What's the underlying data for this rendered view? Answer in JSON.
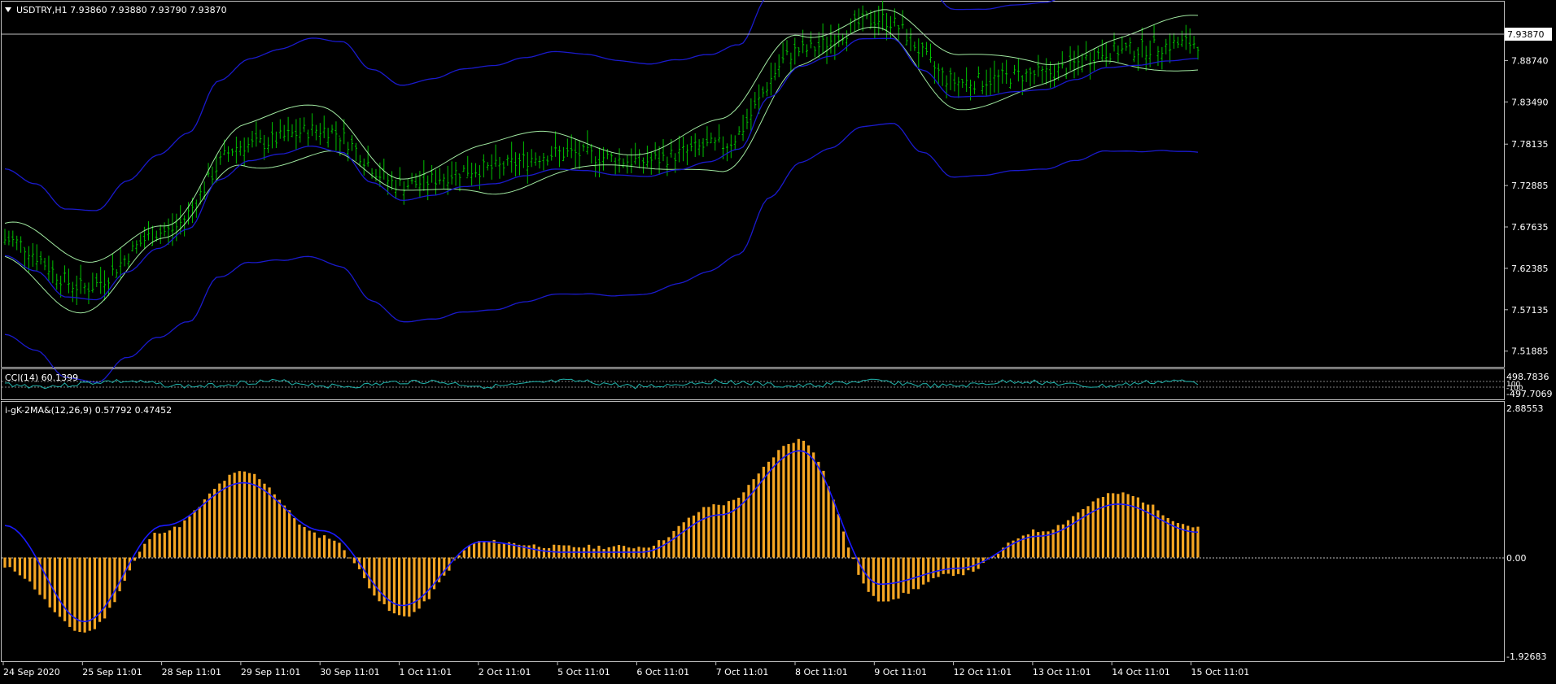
{
  "colors": {
    "background": "#000000",
    "frame": "#c0c0c0",
    "text": "#ffffff",
    "candle": "#00c000",
    "bollinger_inner": "#a0e8a0",
    "bollinger_outer": "#1a1acc",
    "cci_line": "#20b2aa",
    "histogram": "#f5a623",
    "signal_line": "#1a1aff"
  },
  "main_panel": {
    "title_icon": "dropdown-triangle-icon",
    "title": "USDTRY,H1  7.93860 7.93880 7.93790 7.93870",
    "price_ticks": [
      "7.88740",
      "7.83490",
      "7.78135",
      "7.72885",
      "7.67635",
      "7.62385",
      "7.57135",
      "7.51885"
    ],
    "current_price_label": "7.93870"
  },
  "cci_panel": {
    "title": "CCI(14) 60.1399",
    "ticks": [
      "498.7836",
      "100",
      "-100",
      "-497.7069"
    ]
  },
  "macd_panel": {
    "title": "i-gK-2MA&(12,26,9) 0.57792 0.47452",
    "ticks": [
      "2.88553",
      "0.00",
      "-1.92683"
    ]
  },
  "time_axis": [
    "24 Sep 2020",
    "25 Sep 11:01",
    "28 Sep 11:01",
    "29 Sep 11:01",
    "30 Sep 11:01",
    "1 Oct 11:01",
    "2 Oct 11:01",
    "5 Oct 11:01",
    "6 Oct 11:01",
    "7 Oct 11:01",
    "8 Oct 11:01",
    "9 Oct 11:01",
    "12 Oct 11:01",
    "13 Oct 11:01",
    "14 Oct 11:01",
    "15 Oct 11:01"
  ],
  "chart_data": [
    {
      "type": "line",
      "title": "USDTRY,H1  7.93860 7.93880 7.93790 7.93870",
      "x": [
        "24 Sep 2020",
        "25 Sep 11:01",
        "28 Sep 11:01",
        "29 Sep 11:01",
        "30 Sep 11:01",
        "1 Oct 11:01",
        "2 Oct 11:01",
        "5 Oct 11:01",
        "6 Oct 11:01",
        "7 Oct 11:01",
        "8 Oct 11:01",
        "9 Oct 11:01",
        "12 Oct 11:01",
        "13 Oct 11:01",
        "14 Oct 11:01",
        "15 Oct 11:01"
      ],
      "series": [
        {
          "values": [
            7.66,
            7.6,
            7.67,
            7.78,
            7.8,
            7.73,
            7.75,
            7.77,
            7.76,
            7.78,
            7.9,
            7.94,
            7.86,
            7.87,
            7.9,
            7.91
          ]
        }
      ],
      "ylim": [
        7.5,
        7.96
      ],
      "current_value": 7.9387,
      "grid": false
    },
    {
      "type": "line",
      "title": "CCI(14) 60.1399",
      "series": [
        {
          "values": [
            60.1399
          ]
        }
      ],
      "ylim": [
        -497.7069,
        498.7836
      ]
    },
    {
      "type": "bar",
      "title": "i-gK-2MA&(12,26,9) 0.57792 0.47452",
      "categories": [
        "24 Sep 2020",
        "25 Sep 11:01",
        "28 Sep 11:01",
        "29 Sep 11:01",
        "30 Sep 11:01",
        "1 Oct 11:01",
        "2 Oct 11:01",
        "5 Oct 11:01",
        "6 Oct 11:01",
        "7 Oct 11:01",
        "8 Oct 11:01",
        "9 Oct 11:01",
        "12 Oct 11:01",
        "13 Oct 11:01",
        "14 Oct 11:01",
        "15 Oct 11:01"
      ],
      "series": [
        {
          "values": [
            -0.2,
            -1.4,
            0.5,
            1.6,
            0.4,
            -1.1,
            0.3,
            0.2,
            0.2,
            1.0,
            2.2,
            -0.8,
            -0.3,
            0.5,
            1.2,
            0.57792
          ]
        },
        {
          "values": [
            0.6,
            -1.2,
            0.6,
            1.4,
            0.5,
            -0.9,
            0.3,
            0.1,
            0.1,
            0.8,
            2.0,
            -0.5,
            -0.2,
            0.4,
            1.0,
            0.47452
          ]
        }
      ],
      "ylim": [
        -1.92683,
        2.88553
      ]
    }
  ]
}
